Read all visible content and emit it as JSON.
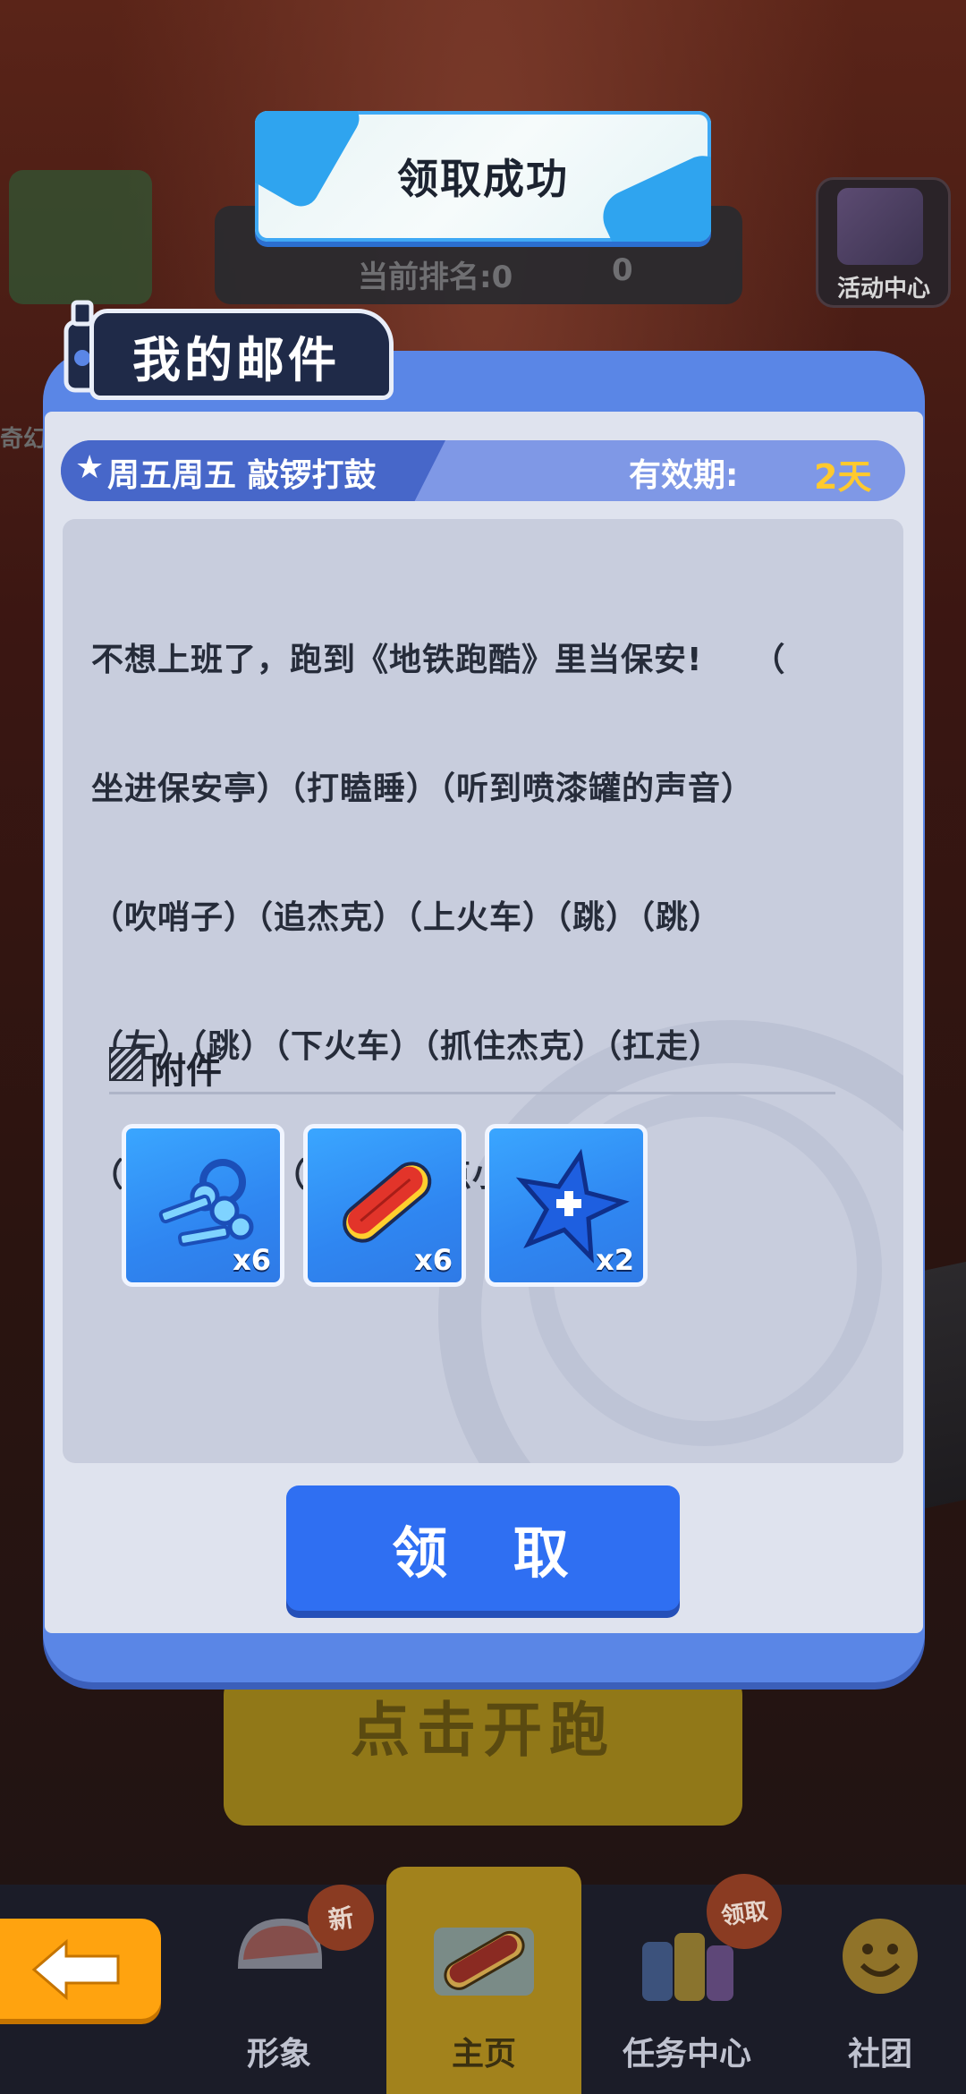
{
  "toast": {
    "message": "领取成功"
  },
  "background": {
    "rank_text": "当前排名:0",
    "trophy_count": "0",
    "event_center_label": "活动中心",
    "left_side_text": "奇幻",
    "start_button_label": "点击开跑"
  },
  "mail": {
    "title": "我的邮件",
    "subject": "周五周五 敲锣打鼓",
    "validity_label": "有效期:",
    "validity_value": "2天",
    "body_lines": [
      "不想上班了，跑到《地铁跑酷》里当保安!　　（",
      "坐进保安亭）（打瞌睡）（听到喷漆罐的声音）",
      "（吹哨子）（追杰克）（上火车）（跳）（跳）",
      "（左）（跳）（下火车）（抓住杰克）（扛走）",
      "（收到工资）（给玩家送点小礼物）"
    ],
    "attachments_label": "附件",
    "attachments": [
      {
        "icon": "keys-icon",
        "count": "x6"
      },
      {
        "icon": "hoverboard-icon",
        "count": "x6"
      },
      {
        "icon": "star-plus-icon",
        "count": "x2"
      }
    ],
    "claim_button_label": "领 取"
  },
  "nav": {
    "items": [
      {
        "label": "形象",
        "badge": "新"
      },
      {
        "label": "主页"
      },
      {
        "label": "任务中心",
        "badge": "领取"
      },
      {
        "label": "社团"
      }
    ]
  },
  "colors": {
    "panel_blue": "#5a86e6",
    "claim_blue": "#2f6ff2",
    "validity_gold": "#ffc92e",
    "back_orange": "#ffa30f"
  }
}
